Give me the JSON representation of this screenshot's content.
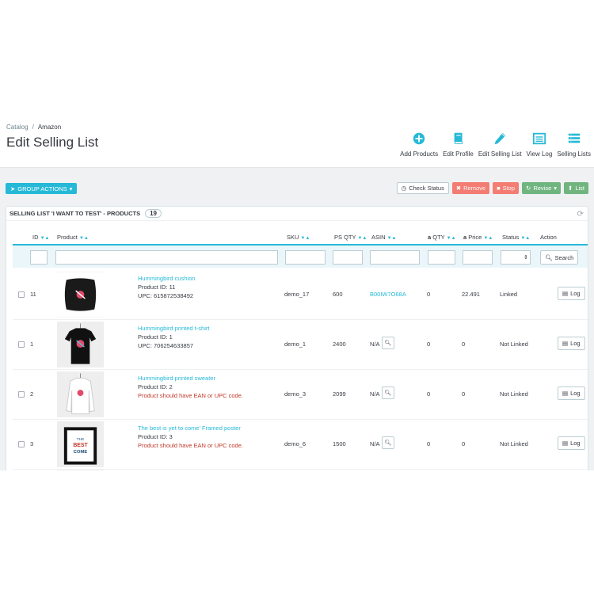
{
  "breadcrumb": {
    "parent": "Catalog",
    "sep": "/",
    "current": "Amazon"
  },
  "page_title": "Edit Selling List",
  "toolbar": [
    {
      "label": "Add Products",
      "icon": "plus-circle-icon"
    },
    {
      "label": "Edit Profile",
      "icon": "book-icon"
    },
    {
      "label": "Edit Selling List",
      "icon": "pencil-icon"
    },
    {
      "label": "View Log",
      "icon": "list-window-icon"
    },
    {
      "label": "Selling Lists",
      "icon": "list-icon"
    }
  ],
  "group_actions": "GROUP ACTIONS",
  "actions": {
    "check_status": "Check Status",
    "remove": "Remove",
    "stop": "Stop",
    "revise": "Revise",
    "list": "List"
  },
  "panel": {
    "title": "SELLING LIST 'I WANT TO TEST' - PRODUCTS",
    "count": "19"
  },
  "columns": {
    "id": "ID",
    "product": "Product",
    "sku": "SKU",
    "ps_qty": "PS QTY",
    "asin": "ASIN",
    "qty": "QTY",
    "price": "Price",
    "status": "Status",
    "action": "Action"
  },
  "search_label": "Search",
  "log_label": "Log",
  "rows": [
    {
      "id": "11",
      "name": "Hummingbird cushion",
      "pid": "Product ID: 11",
      "extra": "UPC: 615872538492",
      "extra_error": false,
      "sku": "demo_17",
      "ps_qty": "600",
      "asin": "B00IW7O68A",
      "qty": "0",
      "price": "22.491",
      "status": "Linked"
    },
    {
      "id": "1",
      "name": "Hummingbird printed t-shirt",
      "pid": "Product ID: 1",
      "extra": "UPC: 706254633857",
      "extra_error": false,
      "sku": "demo_1",
      "ps_qty": "2400",
      "asin": "N/A",
      "qty": "0",
      "price": "0",
      "status": "Not Linked"
    },
    {
      "id": "2",
      "name": "Hummingbird printed sweater",
      "pid": "Product ID: 2",
      "extra": "Product should have EAN or UPC code.",
      "extra_error": true,
      "sku": "demo_3",
      "ps_qty": "2099",
      "asin": "N/A",
      "qty": "0",
      "price": "0",
      "status": "Not Linked"
    },
    {
      "id": "3",
      "name": "The best is yet to come' Framed poster",
      "pid": "Product ID: 3",
      "extra": "Product should have EAN or UPC code.",
      "extra_error": true,
      "sku": "demo_6",
      "ps_qty": "1500",
      "asin": "N/A",
      "qty": "0",
      "price": "0",
      "status": "Not Linked"
    }
  ],
  "colors": {
    "accent": "#25b9d7",
    "danger": "#f54c3e",
    "success": "#70b580",
    "error_text": "#c0392b"
  }
}
